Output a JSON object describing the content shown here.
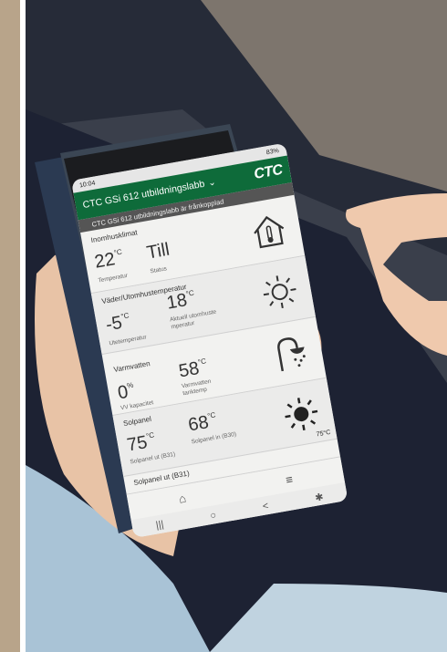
{
  "colors": {
    "header_green": "#0e6b3a",
    "banner_grey": "#555555"
  },
  "status_bar": {
    "time": "10:04",
    "battery": "83%"
  },
  "header": {
    "title": "CTC GSi 612 utbildningslabb",
    "chevron": "⌄",
    "logo": "CTC"
  },
  "banner": {
    "text": "CTC GSi 612 utbildningslabb är frånkopplad"
  },
  "cards": {
    "indoor": {
      "title": "Inomhusklimat",
      "temp_value": "22",
      "temp_unit": "°C",
      "temp_label": "Temperatur",
      "status_value": "Till",
      "status_label": "Status",
      "icon": "house-thermometer-icon"
    },
    "weather": {
      "title": "Väder/Utomhustemperatur",
      "outdoor_value": "-5",
      "outdoor_unit": "°C",
      "outdoor_label": "Utetemperatur",
      "actual_value": "18",
      "actual_unit": "°C",
      "actual_label": "Aktuell utomhuste mperatur",
      "icon": "sun-icon"
    },
    "hotwater": {
      "title": "Varmvatten",
      "capacity_value": "0",
      "capacity_unit": "%",
      "capacity_label": "VV kapacitet",
      "tank_value": "58",
      "tank_unit": "°C",
      "tank_label": "Varmvatten tanktemp",
      "icon": "shower-icon"
    },
    "solar": {
      "title": "Solpanel",
      "out_value": "75",
      "out_unit": "°C",
      "out_label": "Solpanel ut (B31)",
      "in_value": "68",
      "in_unit": "°C",
      "in_label": "Solpanel in (B30)",
      "tag": "75°C",
      "icon": "sun-icon"
    }
  },
  "footer_card": {
    "label": "Solpanel ut (B31)"
  },
  "nav": {
    "home": "⌂",
    "menu": "≡"
  },
  "system_nav": {
    "recent": "|||",
    "home": "○",
    "back": "<",
    "accessibility": "✱"
  }
}
